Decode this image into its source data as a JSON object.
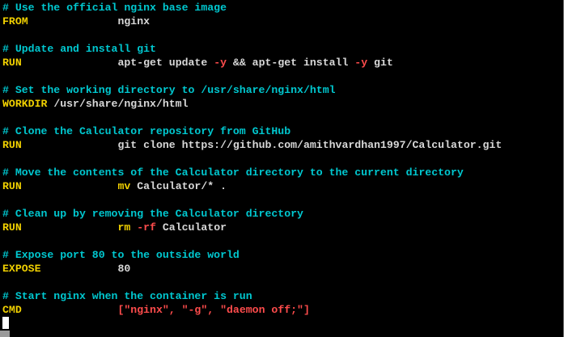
{
  "lines": [
    {
      "kind": "comment",
      "text": "# Use the official nginx base image"
    },
    {
      "kind": "instr",
      "kw": "FROM",
      "args": [
        {
          "t": "txt",
          "v": "nginx"
        }
      ]
    },
    {
      "kind": "comment",
      "text": "# Update and install git"
    },
    {
      "kind": "instr",
      "kw": "RUN",
      "args": [
        {
          "t": "txt",
          "v": "apt-get update "
        },
        {
          "t": "opt",
          "v": "-y"
        },
        {
          "t": "txt",
          "v": " && apt-get install "
        },
        {
          "t": "opt",
          "v": "-y"
        },
        {
          "t": "txt",
          "v": " git"
        }
      ]
    },
    {
      "kind": "comment",
      "text": "# Set the working directory to /usr/share/nginx/html"
    },
    {
      "kind": "instr-inline",
      "kw": "WORKDIR",
      "args": [
        {
          "t": "txt",
          "v": " /usr/share/nginx/html"
        }
      ]
    },
    {
      "kind": "comment",
      "text": "# Clone the Calculator repository from GitHub"
    },
    {
      "kind": "instr",
      "kw": "RUN",
      "args": [
        {
          "t": "txt",
          "v": "git clone https://github.com/amithvardhan1997/Calculator.git"
        }
      ]
    },
    {
      "kind": "comment",
      "text": "# Move the contents of the Calculator directory to the current directory"
    },
    {
      "kind": "instr",
      "kw": "RUN",
      "args": [
        {
          "t": "kw",
          "v": "mv"
        },
        {
          "t": "txt",
          "v": " Calculator/* ."
        }
      ]
    },
    {
      "kind": "comment",
      "text": "# Clean up by removing the Calculator directory"
    },
    {
      "kind": "instr",
      "kw": "RUN",
      "args": [
        {
          "t": "kw",
          "v": "rm"
        },
        {
          "t": "txt",
          "v": " "
        },
        {
          "t": "opt",
          "v": "-rf"
        },
        {
          "t": "txt",
          "v": " Calculator"
        }
      ]
    },
    {
      "kind": "comment",
      "text": "# Expose port 80 to the outside world"
    },
    {
      "kind": "instr",
      "kw": "EXPOSE",
      "args": [
        {
          "t": "txt",
          "v": "80"
        }
      ]
    },
    {
      "kind": "comment",
      "text": "# Start nginx when the container is run"
    },
    {
      "kind": "instr",
      "kw": "CMD",
      "args": [
        {
          "t": "str",
          "v": "[\"nginx\", \"-g\", \"daemon off;\"]"
        }
      ]
    }
  ],
  "colors": {
    "background": "#000000",
    "comment": "#00c8d0",
    "keyword": "#f0d000",
    "text": "#d8d8d8",
    "option": "#ff4c4c"
  }
}
